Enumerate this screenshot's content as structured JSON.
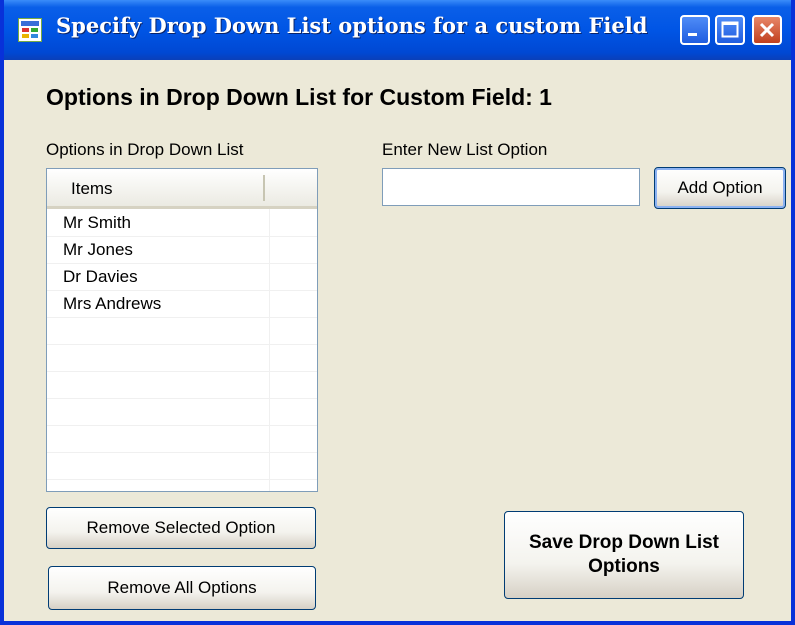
{
  "window": {
    "title": "Specify Drop Down List options for a custom Field"
  },
  "heading": "Options in Drop Down List for Custom Field: 1",
  "list": {
    "label": "Options in Drop Down List",
    "column_header": "Items",
    "items": [
      "Mr Smith",
      "Mr Jones",
      "Dr Davies",
      "Mrs Andrews"
    ]
  },
  "new_option": {
    "label": "Enter New List Option",
    "value": "",
    "add_button": "Add Option"
  },
  "buttons": {
    "remove_selected": "Remove Selected Option",
    "remove_all": "Remove All Options",
    "save": "Save Drop Down List Options"
  },
  "icons": {
    "app": "form-icon",
    "minimize": "minimize-icon",
    "maximize": "maximize-icon",
    "close": "close-icon"
  },
  "colors": {
    "titlebar": "#0055e5",
    "window_bg": "#ece9d8",
    "close_button": "#c1401f"
  }
}
